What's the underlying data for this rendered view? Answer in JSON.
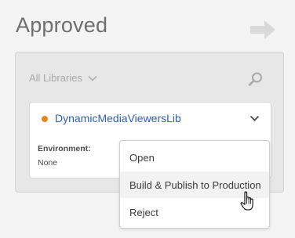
{
  "page": {
    "title": "Approved"
  },
  "filter": {
    "label": "All Libraries"
  },
  "card": {
    "status_color": "#e68619",
    "library_name": "DynamicMediaViewersLib",
    "environment_label": "Environment:",
    "environment_value": "None"
  },
  "menu": {
    "items": [
      {
        "label": "Open"
      },
      {
        "label": "Build & Publish to Production",
        "hovered": true
      },
      {
        "label": "Reject"
      }
    ]
  },
  "icons": {
    "next": "arrow-right-icon",
    "search": "search-icon",
    "filter_toggle": "chevron-down-icon",
    "card_toggle": "chevron-down-icon",
    "pointer": "hand-pointer-icon"
  }
}
